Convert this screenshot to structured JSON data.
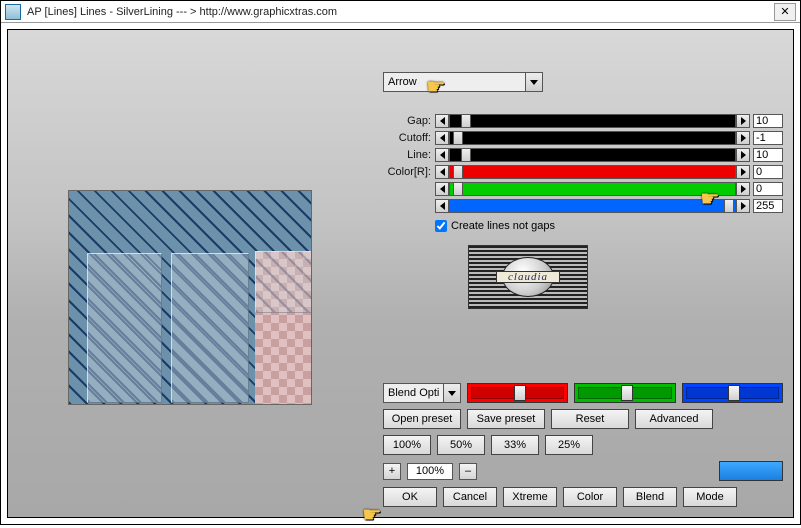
{
  "window": {
    "title": "AP [Lines]  Lines - SilverLining   --- >  http://www.graphicxtras.com",
    "close_icon": "✕"
  },
  "selector": {
    "selected": "Arrow"
  },
  "params": [
    {
      "label": "Gap:",
      "value": "10",
      "bar_color": "#000",
      "thumb_left_pct": 4
    },
    {
      "label": "Cutoff:",
      "value": "-1",
      "bar_color": "#000",
      "thumb_left_pct": 1
    },
    {
      "label": "Line:",
      "value": "10",
      "bar_color": "#000",
      "thumb_left_pct": 4
    },
    {
      "label": "Color[R]:",
      "value": "0",
      "bar_color": "#e00",
      "thumb_left_pct": 1
    },
    {
      "label": "",
      "value": "0",
      "bar_color": "#0c0",
      "thumb_left_pct": 1
    },
    {
      "label": "",
      "value": "255",
      "bar_color": "#06f",
      "thumb_left_pct": 96
    }
  ],
  "checkbox": {
    "label": "Create lines not gaps",
    "checked": true
  },
  "logo_text": "claudia",
  "blend_selector": "Blend Opti",
  "preset_row": {
    "open": "Open preset",
    "save": "Save preset",
    "reset": "Reset",
    "advanced": "Advanced"
  },
  "pct_presets": [
    "100%",
    "50%",
    "33%",
    "25%"
  ],
  "zoom": {
    "minus": "–",
    "value": "100%",
    "plus": "+"
  },
  "action_row": [
    "OK",
    "Cancel",
    "Xtreme",
    "Color",
    "Blend",
    "Mode"
  ]
}
